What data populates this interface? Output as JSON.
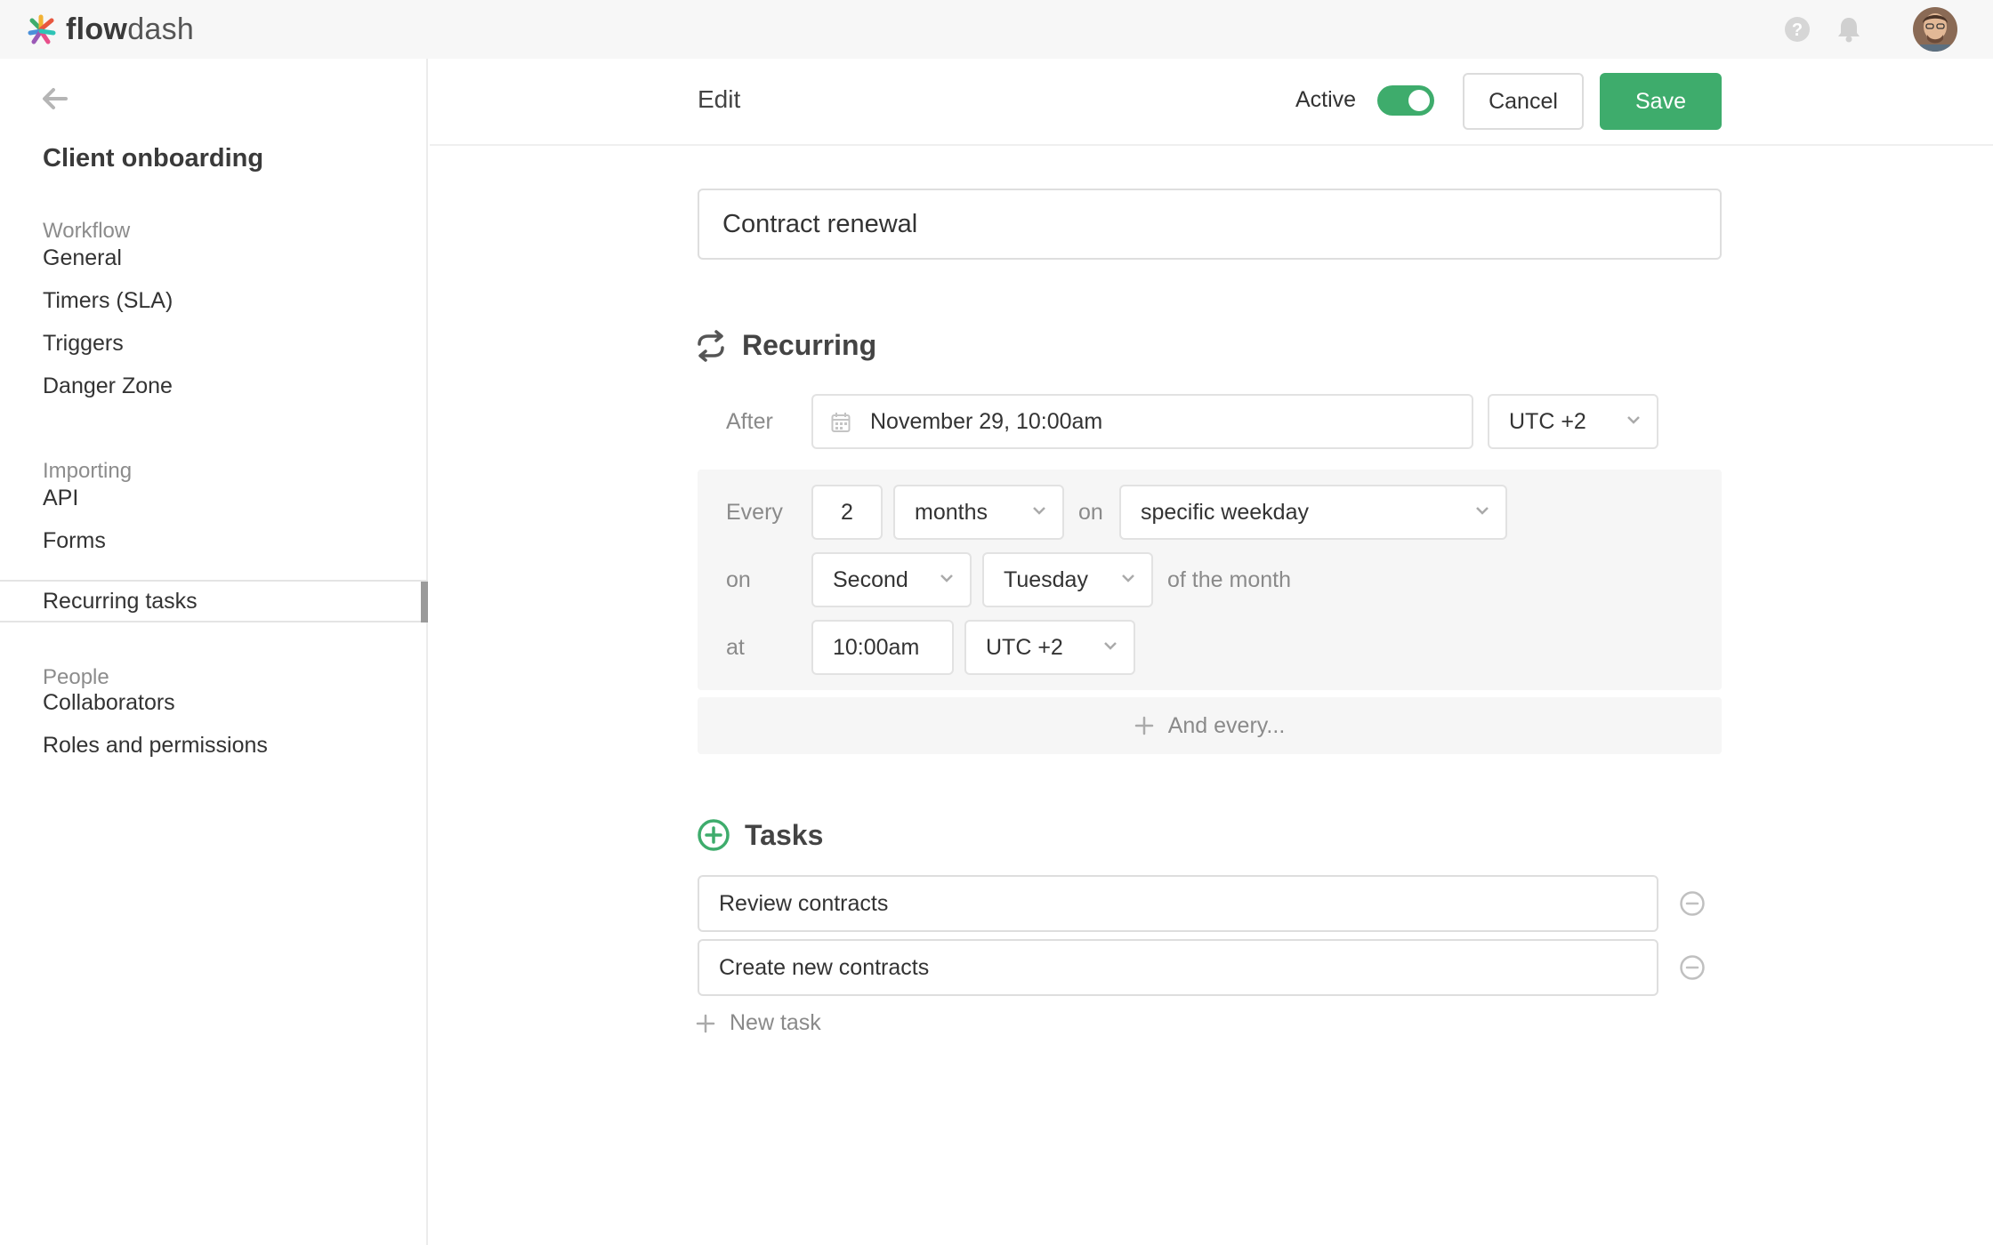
{
  "app": {
    "logo_bold": "flow",
    "logo_light": "dash"
  },
  "topbar": {
    "help_icon": "help-circle-icon",
    "bell_icon": "bell-icon",
    "avatar": "user-avatar"
  },
  "sidebar": {
    "title": "Client onboarding",
    "sections": [
      {
        "label": "Workflow",
        "items": [
          "General",
          "Timers (SLA)",
          "Triggers",
          "Danger Zone"
        ]
      },
      {
        "label": "Importing",
        "items": [
          "API",
          "Forms",
          "Recurring tasks"
        ]
      },
      {
        "label": "People",
        "items": [
          "Collaborators",
          "Roles and permissions"
        ]
      }
    ],
    "active_item": "Recurring tasks"
  },
  "header": {
    "title": "Edit",
    "active_label": "Active",
    "active": true,
    "cancel": "Cancel",
    "save": "Save"
  },
  "form": {
    "name": "Contract renewal",
    "recurring": {
      "heading": "Recurring",
      "after_label": "After",
      "after_value": "November 29, 10:00am",
      "after_tz": "UTC +2",
      "every_label": "Every",
      "every_count": "2",
      "every_unit": "months",
      "on_label_1": "on",
      "on_mode": "specific weekday",
      "on_label_2": "on",
      "ordinal": "Second",
      "weekday": "Tuesday",
      "of_month": "of the month",
      "at_label": "at",
      "at_time": "10:00am",
      "at_tz": "UTC +2",
      "and_every": "And every..."
    },
    "tasks": {
      "heading": "Tasks",
      "items": [
        "Review contracts",
        "Create new contracts"
      ],
      "new_task": "New task"
    }
  },
  "colors": {
    "accent": "#3eac6c"
  }
}
